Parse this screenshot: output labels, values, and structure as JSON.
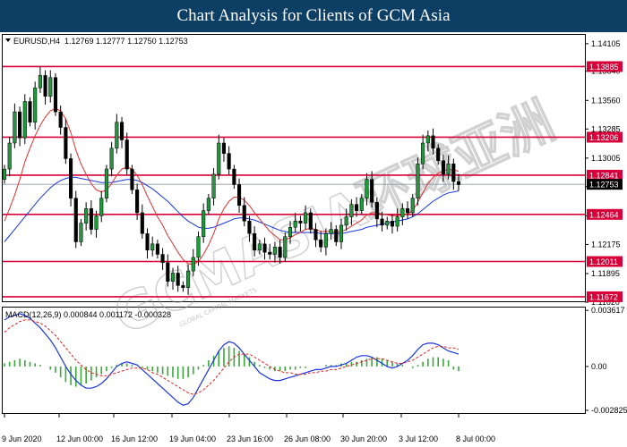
{
  "header": {
    "title": "Chart Analysis for Clients of GCM Asia"
  },
  "watermark": {
    "text": "GCMASIA环球亚洲",
    "subtext": "GLOBAL CAPITAL MARKETS"
  },
  "chart_data": {
    "type": "candlestick",
    "symbol": "EURUSD,H4",
    "ohlc_label": "1.12769 1.12777 1.12750 1.12753",
    "current_price": 1.12753,
    "price_axis": {
      "ylim": [
        1.1162,
        1.1419
      ],
      "ticks": [
        1.14105,
        1.1384,
        1.1356,
        1.13285,
        1.13005,
        1.1273,
        1.1245,
        1.12175,
        1.11895,
        1.1162
      ],
      "tick_labels": [
        "1.14105",
        "1.13840",
        "1.13560",
        "1.13285",
        "1.13005",
        "1.12730",
        "1.12450",
        "1.12175",
        "1.11895",
        "1.11620"
      ]
    },
    "levels": [
      {
        "value": 1.13885,
        "label": "1.13885"
      },
      {
        "value": 1.13206,
        "label": "1.13206"
      },
      {
        "value": 1.12841,
        "label": "1.12841"
      },
      {
        "value": 1.12464,
        "label": "1.12464"
      },
      {
        "value": 1.12011,
        "label": "1.12011"
      },
      {
        "value": 1.11672,
        "label": "1.11672"
      }
    ],
    "x_labels": [
      "9 Jun 2020",
      "12 Jun 00:00",
      "16 Jun 12:00",
      "19 Jun 04:00",
      "23 Jun 16:00",
      "26 Jun 08:00",
      "30 Jun 20:00",
      "3 Jul 12:00",
      "8 Jul 00:00"
    ],
    "closes": [
      1.129,
      1.1315,
      1.1345,
      1.132,
      1.1355,
      1.1335,
      1.1368,
      1.138,
      1.136,
      1.1378,
      1.1345,
      1.133,
      1.13,
      1.1262,
      1.122,
      1.1238,
      1.1252,
      1.1232,
      1.1245,
      1.1262,
      1.129,
      1.131,
      1.1335,
      1.1318,
      1.129,
      1.127,
      1.1248,
      1.1228,
      1.1212,
      1.1218,
      1.1208,
      1.12,
      1.1182,
      1.119,
      1.1178,
      1.1176,
      1.1192,
      1.1205,
      1.1225,
      1.125,
      1.1262,
      1.1285,
      1.1315,
      1.1305,
      1.129,
      1.1275,
      1.1255,
      1.124,
      1.1228,
      1.1212,
      1.1218,
      1.121,
      1.1208,
      1.1215,
      1.1205,
      1.1225,
      1.1234,
      1.124,
      1.1238,
      1.1248,
      1.1232,
      1.1222,
      1.1215,
      1.1228,
      1.1232,
      1.122,
      1.1236,
      1.1244,
      1.1256,
      1.125,
      1.1262,
      1.128,
      1.1258,
      1.1242,
      1.1236,
      1.124,
      1.1235,
      1.1244,
      1.1252,
      1.1248,
      1.1262,
      1.1295,
      1.1315,
      1.1322,
      1.131,
      1.1298,
      1.1285,
      1.1295,
      1.1278,
      1.1275
    ],
    "ma_red": [
      1.124,
      1.1252,
      1.1265,
      1.128,
      1.1297,
      1.131,
      1.1322,
      1.1332,
      1.134,
      1.1346,
      1.1348,
      1.1346,
      1.1338,
      1.1325,
      1.1308,
      1.1295,
      1.1285,
      1.1276,
      1.127,
      1.1268,
      1.127,
      1.1276,
      1.1284,
      1.129,
      1.1292,
      1.129,
      1.1284,
      1.1275,
      1.1264,
      1.1254,
      1.1244,
      1.1236,
      1.1226,
      1.1218,
      1.121,
      1.1203,
      1.1199,
      1.1198,
      1.1201,
      1.1208,
      1.1217,
      1.1228,
      1.1242,
      1.1252,
      1.1259,
      1.1263,
      1.1263,
      1.126,
      1.1255,
      1.1248,
      1.1242,
      1.1236,
      1.123,
      1.1226,
      1.1222,
      1.1222,
      1.1224,
      1.1227,
      1.1229,
      1.1232,
      1.1233,
      1.1232,
      1.123,
      1.123,
      1.123,
      1.1229,
      1.123,
      1.1232,
      1.1235,
      1.1238,
      1.1241,
      1.1246,
      1.1248,
      1.1248,
      1.1247,
      1.1246,
      1.1245,
      1.1245,
      1.1246,
      1.1247,
      1.125,
      1.1258,
      1.1267,
      1.1276,
      1.1282,
      1.1286,
      1.1288,
      1.129,
      1.1289,
      1.1288
    ],
    "ma_blue": [
      1.122,
      1.1226,
      1.1232,
      1.1238,
      1.1244,
      1.125,
      1.1256,
      1.1262,
      1.1267,
      1.1272,
      1.1276,
      1.1279,
      1.1281,
      1.1282,
      1.1282,
      1.1281,
      1.128,
      1.1279,
      1.1278,
      1.1277,
      1.1277,
      1.1277,
      1.1278,
      1.1279,
      1.128,
      1.128,
      1.1279,
      1.1277,
      1.1274,
      1.1271,
      1.1267,
      1.1263,
      1.1259,
      1.1254,
      1.1249,
      1.1244,
      1.124,
      1.1237,
      1.1234,
      1.1233,
      1.1233,
      1.1234,
      1.1236,
      1.1238,
      1.124,
      1.1242,
      1.1243,
      1.1243,
      1.1242,
      1.1241,
      1.1239,
      1.1237,
      1.1235,
      1.1233,
      1.1231,
      1.123,
      1.1229,
      1.1229,
      1.1229,
      1.1229,
      1.1229,
      1.1229,
      1.1228,
      1.1228,
      1.1228,
      1.1228,
      1.1228,
      1.1229,
      1.123,
      1.1231,
      1.1232,
      1.1234,
      1.1235,
      1.1236,
      1.1237,
      1.1238,
      1.1239,
      1.124,
      1.1241,
      1.1242,
      1.1244,
      1.1247,
      1.1251,
      1.1255,
      1.1259,
      1.1262,
      1.1265,
      1.1267,
      1.1268,
      1.1269
    ],
    "macd": {
      "label": "MACD(12,26,9) 0.000844 0.001172 -0.000328",
      "ylim": [
        -0.003,
        0.0038
      ],
      "ticks": [
        0.003617,
        0.0,
        -0.002825
      ],
      "tick_labels": [
        "0.003617",
        "0.00",
        "-0.002825"
      ],
      "histogram": [
        0.0002,
        0.0003,
        0.0004,
        0.0005,
        0.0004,
        0.0003,
        0.0002,
        0.0001,
        0.0,
        -0.0002,
        -0.0004,
        -0.0007,
        -0.001,
        -0.0012,
        -0.0013,
        -0.0012,
        -0.0011,
        -0.0009,
        -0.0007,
        -0.0005,
        -0.0003,
        -0.0001,
        0.0001,
        0.0002,
        0.0002,
        0.0001,
        0.0,
        -0.0001,
        -0.0002,
        -0.0003,
        -0.0004,
        -0.0005,
        -0.0006,
        -0.0007,
        -0.0008,
        -0.0008,
        -0.0007,
        -0.0005,
        -0.0002,
        0.0001,
        0.0004,
        0.0007,
        0.001,
        0.0012,
        0.0013,
        0.0012,
        0.001,
        0.0008,
        0.0006,
        0.0003,
        0.0001,
        -0.0001,
        -0.0002,
        -0.0003,
        -0.0003,
        -0.0003,
        -0.0002,
        -0.0002,
        -0.0001,
        -0.0001,
        0.0,
        0.0,
        0.0,
        0.0001,
        0.0001,
        0.0001,
        0.0002,
        0.0002,
        0.0003,
        0.0003,
        0.0004,
        0.0005,
        0.0006,
        0.0006,
        0.0005,
        0.0004,
        0.0003,
        0.0002,
        0.0001,
        0.0,
        -0.0001,
        0.0001,
        0.0003,
        0.0005,
        0.0006,
        0.0006,
        0.0005,
        0.0004,
        -0.0002,
        -0.0003
      ],
      "macd_line": [
        0.003,
        0.0032,
        0.0033,
        0.0034,
        0.0033,
        0.0031,
        0.0028,
        0.0025,
        0.0021,
        0.0017,
        0.0012,
        0.0006,
        0.0,
        -0.0005,
        -0.0009,
        -0.0012,
        -0.0014,
        -0.0014,
        -0.0013,
        -0.0011,
        -0.0008,
        -0.0004,
        0.0,
        0.0002,
        0.0003,
        0.0002,
        0.0001,
        -0.0002,
        -0.0005,
        -0.0008,
        -0.0011,
        -0.0014,
        -0.0017,
        -0.002,
        -0.0023,
        -0.0025,
        -0.0024,
        -0.002,
        -0.0014,
        -0.0008,
        -0.0002,
        0.0004,
        0.001,
        0.0014,
        0.0016,
        0.0015,
        0.0012,
        0.0008,
        0.0004,
        0.0,
        -0.0004,
        -0.0006,
        -0.0008,
        -0.0009,
        -0.0009,
        -0.0008,
        -0.0007,
        -0.0006,
        -0.0005,
        -0.0004,
        -0.0003,
        -0.0002,
        -0.0002,
        -0.0001,
        0.0,
        0.0,
        0.0001,
        0.0002,
        0.0004,
        0.0006,
        0.0007,
        0.0007,
        0.0006,
        0.0004,
        0.0002,
        0.0,
        -0.0001,
        0.0,
        0.0002,
        0.0004,
        0.0007,
        0.0011,
        0.0014,
        0.0015,
        0.0015,
        0.0014,
        0.0012,
        0.001,
        0.0009,
        0.0008
      ],
      "signal_line": [
        0.0022,
        0.0025,
        0.0027,
        0.0029,
        0.003,
        0.003,
        0.0029,
        0.0028,
        0.0026,
        0.0023,
        0.002,
        0.0016,
        0.0012,
        0.0008,
        0.0004,
        0.0001,
        -0.0002,
        -0.0004,
        -0.0005,
        -0.0006,
        -0.0006,
        -0.0005,
        -0.0004,
        -0.0003,
        -0.0002,
        -0.0001,
        -0.0001,
        -0.0001,
        -0.0002,
        -0.0004,
        -0.0005,
        -0.0007,
        -0.0009,
        -0.0011,
        -0.0013,
        -0.0015,
        -0.0017,
        -0.0018,
        -0.0017,
        -0.0015,
        -0.0012,
        -0.0009,
        -0.0005,
        -0.0001,
        0.0003,
        0.0006,
        0.0008,
        0.0008,
        0.0008,
        0.0006,
        0.0004,
        0.0002,
        0.0,
        -0.0002,
        -0.0003,
        -0.0004,
        -0.0004,
        -0.0005,
        -0.0005,
        -0.0005,
        -0.0004,
        -0.0004,
        -0.0003,
        -0.0003,
        -0.0002,
        -0.0002,
        -0.0001,
        0.0,
        0.0001,
        0.0002,
        0.0003,
        0.0004,
        0.0005,
        0.0005,
        0.0005,
        0.0004,
        0.0003,
        0.0002,
        0.0002,
        0.0003,
        0.0004,
        0.0006,
        0.0008,
        0.001,
        0.0012,
        0.0013,
        0.0013,
        0.0012,
        0.0012,
        0.0011
      ]
    }
  },
  "colors": {
    "banner": "#0d3f64",
    "level_line": "#d7003a",
    "ma_red": "#e03030",
    "ma_blue": "#1a35e0",
    "bull": "#1f9a3a",
    "bear": "#000000",
    "macd_hist": "#39a839",
    "macd_line": "#1a35e0",
    "signal_line": "#e02020"
  }
}
